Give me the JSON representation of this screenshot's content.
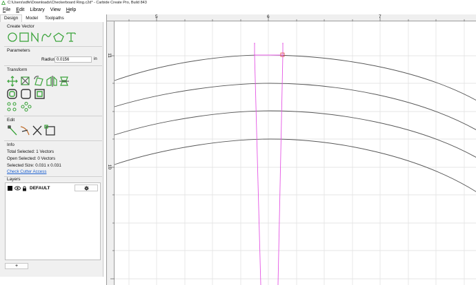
{
  "window": {
    "title": "C:\\Users\\sdfe\\Downloads\\Checkerboard Ring.c2d* - Carbide Create Pro, Build 843"
  },
  "menu": {
    "items": [
      {
        "label": "File",
        "underline": "F",
        "rest": "ile"
      },
      {
        "label": "Edit",
        "underline": "E",
        "rest": "dit"
      },
      {
        "label": "Library",
        "underline": "",
        "rest": "Library"
      },
      {
        "label": "View",
        "underline": "",
        "rest": "View"
      },
      {
        "label": "Help",
        "underline": "H",
        "rest": "elp"
      }
    ]
  },
  "tabs": [
    {
      "label": "Design",
      "active": true
    },
    {
      "label": "Model",
      "active": false
    },
    {
      "label": "Toolpaths",
      "active": false
    }
  ],
  "sections": {
    "create_vector": "Create Vector",
    "parameters": "Parameters",
    "transform": "Transform",
    "edit": "Edit",
    "info": "Info",
    "layers": "Layers"
  },
  "parameters": {
    "radius_label": "Radius",
    "radius_value": "0.0156",
    "radius_unit": "in"
  },
  "info": {
    "total_selected": "Total Selected:   1 Vectors",
    "open_selected": "Open Selected:   0 Vectors",
    "selected_size": "Selected Size:    0.031 x 0.031",
    "check_cutter": "Check Cutter Access"
  },
  "layers": {
    "items": [
      {
        "name": "DEFAULT",
        "color": "#000000"
      }
    ],
    "add_label": "+",
    "gear_icon": "gear-icon"
  },
  "canvas": {
    "ruler_x_labels": [
      "5",
      "6",
      "7"
    ],
    "ruler_y_labels": [
      "11",
      "10"
    ],
    "curve_color": "#555555",
    "selection_color": "#e455e4",
    "grid_color": "#dedede"
  },
  "colors": {
    "accent_green": "#3aa33a",
    "link_blue": "#1a5fd0",
    "highlight_red": "#e04040"
  }
}
